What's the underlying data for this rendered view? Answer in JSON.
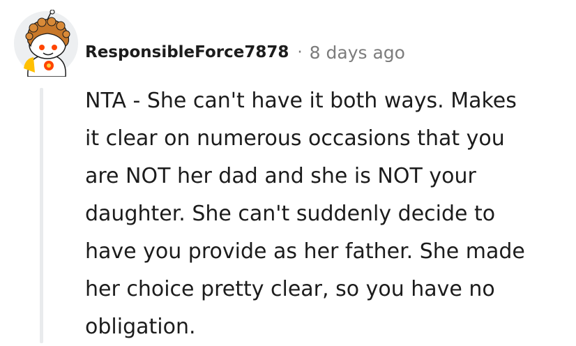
{
  "comment": {
    "author": "ResponsibleForce7878",
    "separator": "·",
    "timestamp": "8 days ago",
    "avatar_icon": "snoo-avatar-icon",
    "body_lines": [
      "NTA - She can't have it both ways. Makes",
      "it clear on numerous occasions that you",
      "are NOT her dad and she is NOT your",
      "daughter. She can't suddenly decide to",
      "have you provide as her father. She made",
      "her choice pretty clear, so you have no",
      "obligation."
    ]
  },
  "colors": {
    "text": "#1c1c1c",
    "meta": "#7c7c7c",
    "thread_line": "#e9ebed",
    "avatar_head": "#ff4500",
    "avatar_hair": "#c8782a"
  }
}
